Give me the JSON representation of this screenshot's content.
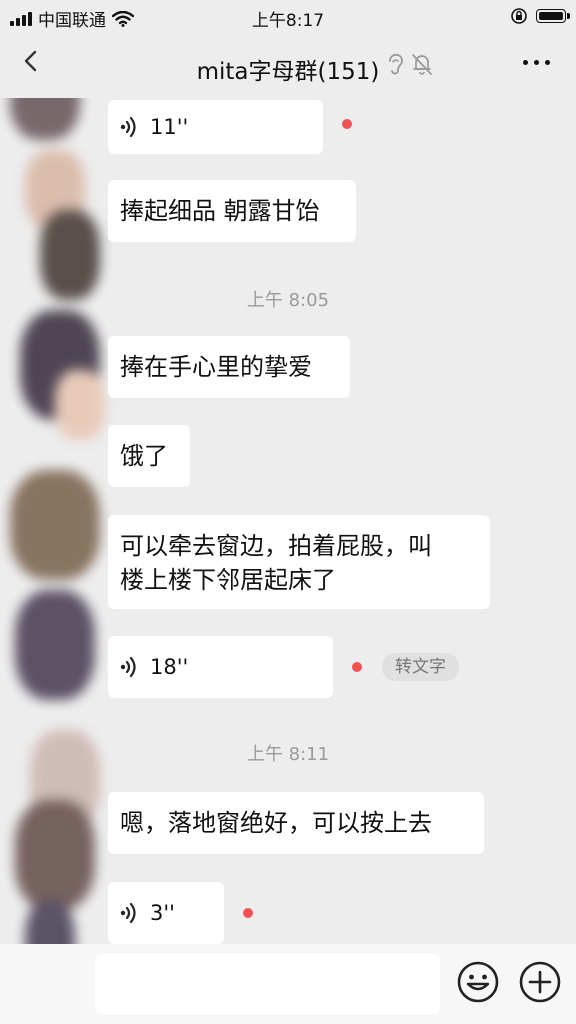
{
  "status_bar": {
    "carrier": "中国联通",
    "time": "上午8:17"
  },
  "header": {
    "title": "mita字母群(151)"
  },
  "messages": [
    {
      "type": "voice",
      "duration": "11''"
    },
    {
      "type": "text",
      "text": "捧起细品 朝露甘饴"
    },
    {
      "type": "time",
      "text": "上午 8:05"
    },
    {
      "type": "text",
      "text": "捧在手心里的挚爱"
    },
    {
      "type": "text",
      "text": "饿了"
    },
    {
      "type": "text",
      "lines": [
        "可以牵去窗边，拍着屁股，叫",
        "楼上楼下邻居起床了"
      ]
    },
    {
      "type": "voice",
      "duration": "18''",
      "convert_label": "转文字"
    },
    {
      "type": "time",
      "text": "上午 8:11"
    },
    {
      "type": "text",
      "text": "嗯，落地窗绝好，可以按上去"
    },
    {
      "type": "voice",
      "duration": "3''"
    }
  ],
  "input_bar": {
    "input_value": ""
  },
  "colors": {
    "background": "#ededed",
    "bubble": "#ffffff",
    "unread_dot": "#f25151",
    "timestamp": "#9a9a9a"
  },
  "icons": [
    "signal-icon",
    "wifi-icon",
    "lock-rotation-icon",
    "battery-icon",
    "back-icon",
    "ear-icon",
    "mute-bell-icon",
    "more-icon",
    "voice-wave-icon",
    "emoji-icon",
    "plus-icon"
  ]
}
